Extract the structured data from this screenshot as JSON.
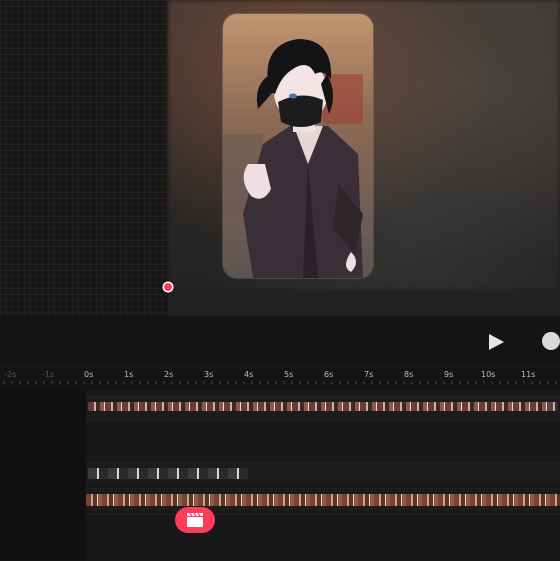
{
  "preview": {
    "accent_color": "#ff3b5c",
    "character_description_icon": "character-image"
  },
  "controls": {
    "play_icon": "play-icon",
    "record_icon": "record-icon"
  },
  "ruler": {
    "ticks": [
      "-2s",
      "-1s",
      "0s",
      "1s",
      "2s",
      "3s",
      "4s",
      "5s",
      "6s",
      "7s",
      "8s",
      "9s",
      "10s",
      "11s"
    ]
  },
  "timeline": {
    "add_clip_icon": "clapperboard-icon"
  }
}
